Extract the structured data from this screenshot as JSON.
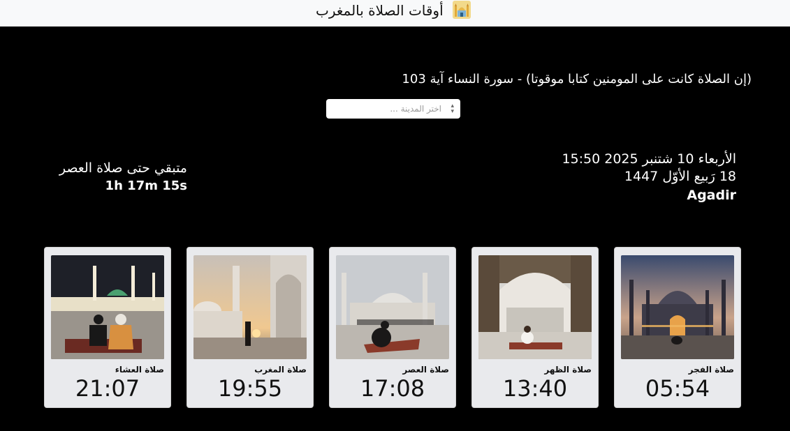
{
  "header": {
    "title": "أوقات الصلاة بالمغرب",
    "icon": "mosque-icon"
  },
  "verse": "(إن الصلاة كانت على المومنين كتابا موقوتا) - سورة النساء آية 103",
  "city_select": {
    "placeholder": "اختر المدينة ..."
  },
  "date_info": {
    "gregorian": "الأربعاء 10 شتنبر 2025 15:50",
    "hijri": "18 رَبيع الأوّل 1447",
    "city": "Agadir"
  },
  "countdown": {
    "label": "متبقي حتى صلاة العصر",
    "remaining": "1h 17m 15s"
  },
  "prayers": [
    {
      "name": "صلاة الفجر",
      "time": "05:54"
    },
    {
      "name": "صلاة الظهر",
      "time": "13:40"
    },
    {
      "name": "صلاة العصر",
      "time": "17:08"
    },
    {
      "name": "صلاة المغرب",
      "time": "19:55"
    },
    {
      "name": "صلاة العشاء",
      "time": "21:07"
    }
  ],
  "colors": {
    "page_bg": "#000000",
    "navbar_bg": "#f8f9fa",
    "card_bg": "#e9eaed"
  }
}
